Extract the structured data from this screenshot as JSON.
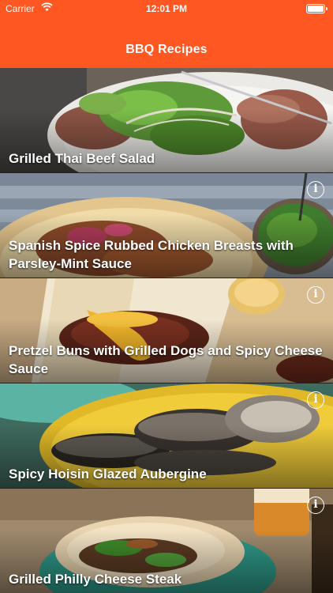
{
  "status_bar": {
    "carrier": "Carrier",
    "time": "12:01 PM",
    "wifi_icon": "wifi-icon",
    "battery_icon": "battery-icon"
  },
  "nav": {
    "title": "BBQ Recipes",
    "background": "#ff5722"
  },
  "recipes": [
    {
      "title": "Grilled Thai Beef Salad",
      "info_icon": "info-icon"
    },
    {
      "title": "Spanish Spice Rubbed Chicken Breasts with Parsley-Mint Sauce",
      "info_icon": "info-icon"
    },
    {
      "title": "Pretzel Buns with Grilled Dogs and Spicy Cheese Sauce",
      "info_icon": "info-icon"
    },
    {
      "title": "Spicy Hoisin Glazed Aubergine",
      "info_icon": "info-icon"
    },
    {
      "title": "Grilled Philly Cheese Steak",
      "info_icon": "info-icon"
    }
  ],
  "info_glyph": "i"
}
